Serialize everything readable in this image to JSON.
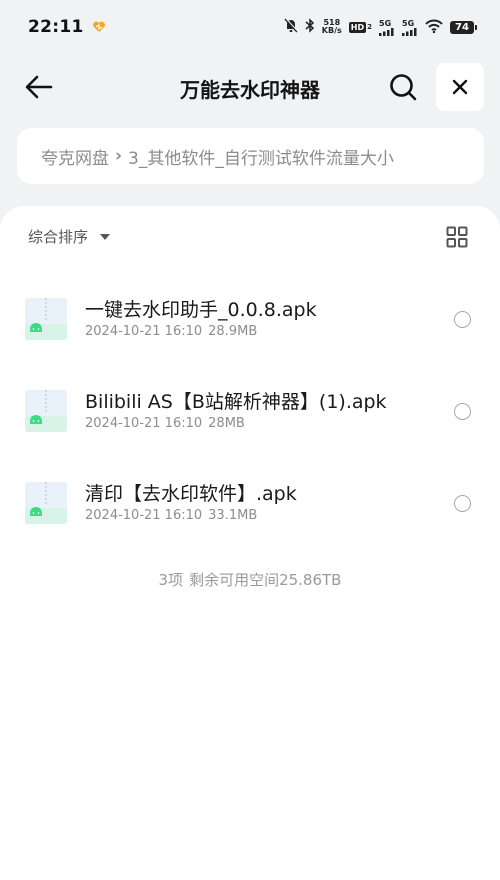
{
  "status_bar": {
    "time": "22:11",
    "net_speed_value": "518",
    "net_speed_unit": "KB/s",
    "hd_label": "HD",
    "signal1_label": "5G",
    "signal2_label": "5G",
    "battery": "74"
  },
  "header": {
    "title": "万能去水印神器"
  },
  "breadcrumb": {
    "root": "夸克网盘",
    "current": "3_其他软件_自行测试软件流量大小"
  },
  "toolbar": {
    "sort_label": "综合排序"
  },
  "files": [
    {
      "name": "一键去水印助手_0.0.8.apk",
      "date": "2024-10-21 16:10",
      "size": "28.9MB"
    },
    {
      "name": "Bilibili AS【B站解析神器】(1).apk",
      "date": "2024-10-21 16:10",
      "size": "28MB"
    },
    {
      "name": "清印【去水印软件】.apk",
      "date": "2024-10-21 16:10",
      "size": "33.1MB"
    }
  ],
  "summary": {
    "count": "3项",
    "space": "剩余可用空间25.86TB"
  },
  "colors": {
    "background": "#f1f2f4",
    "panel": "#ffffff",
    "android_green": "#3ddc84",
    "icon_tint": "#e6eef8"
  },
  "icons": {
    "back": "arrow-left-icon",
    "search": "search-icon",
    "close": "close-icon",
    "grid": "grid-view-icon",
    "file": "apk-file-icon"
  }
}
